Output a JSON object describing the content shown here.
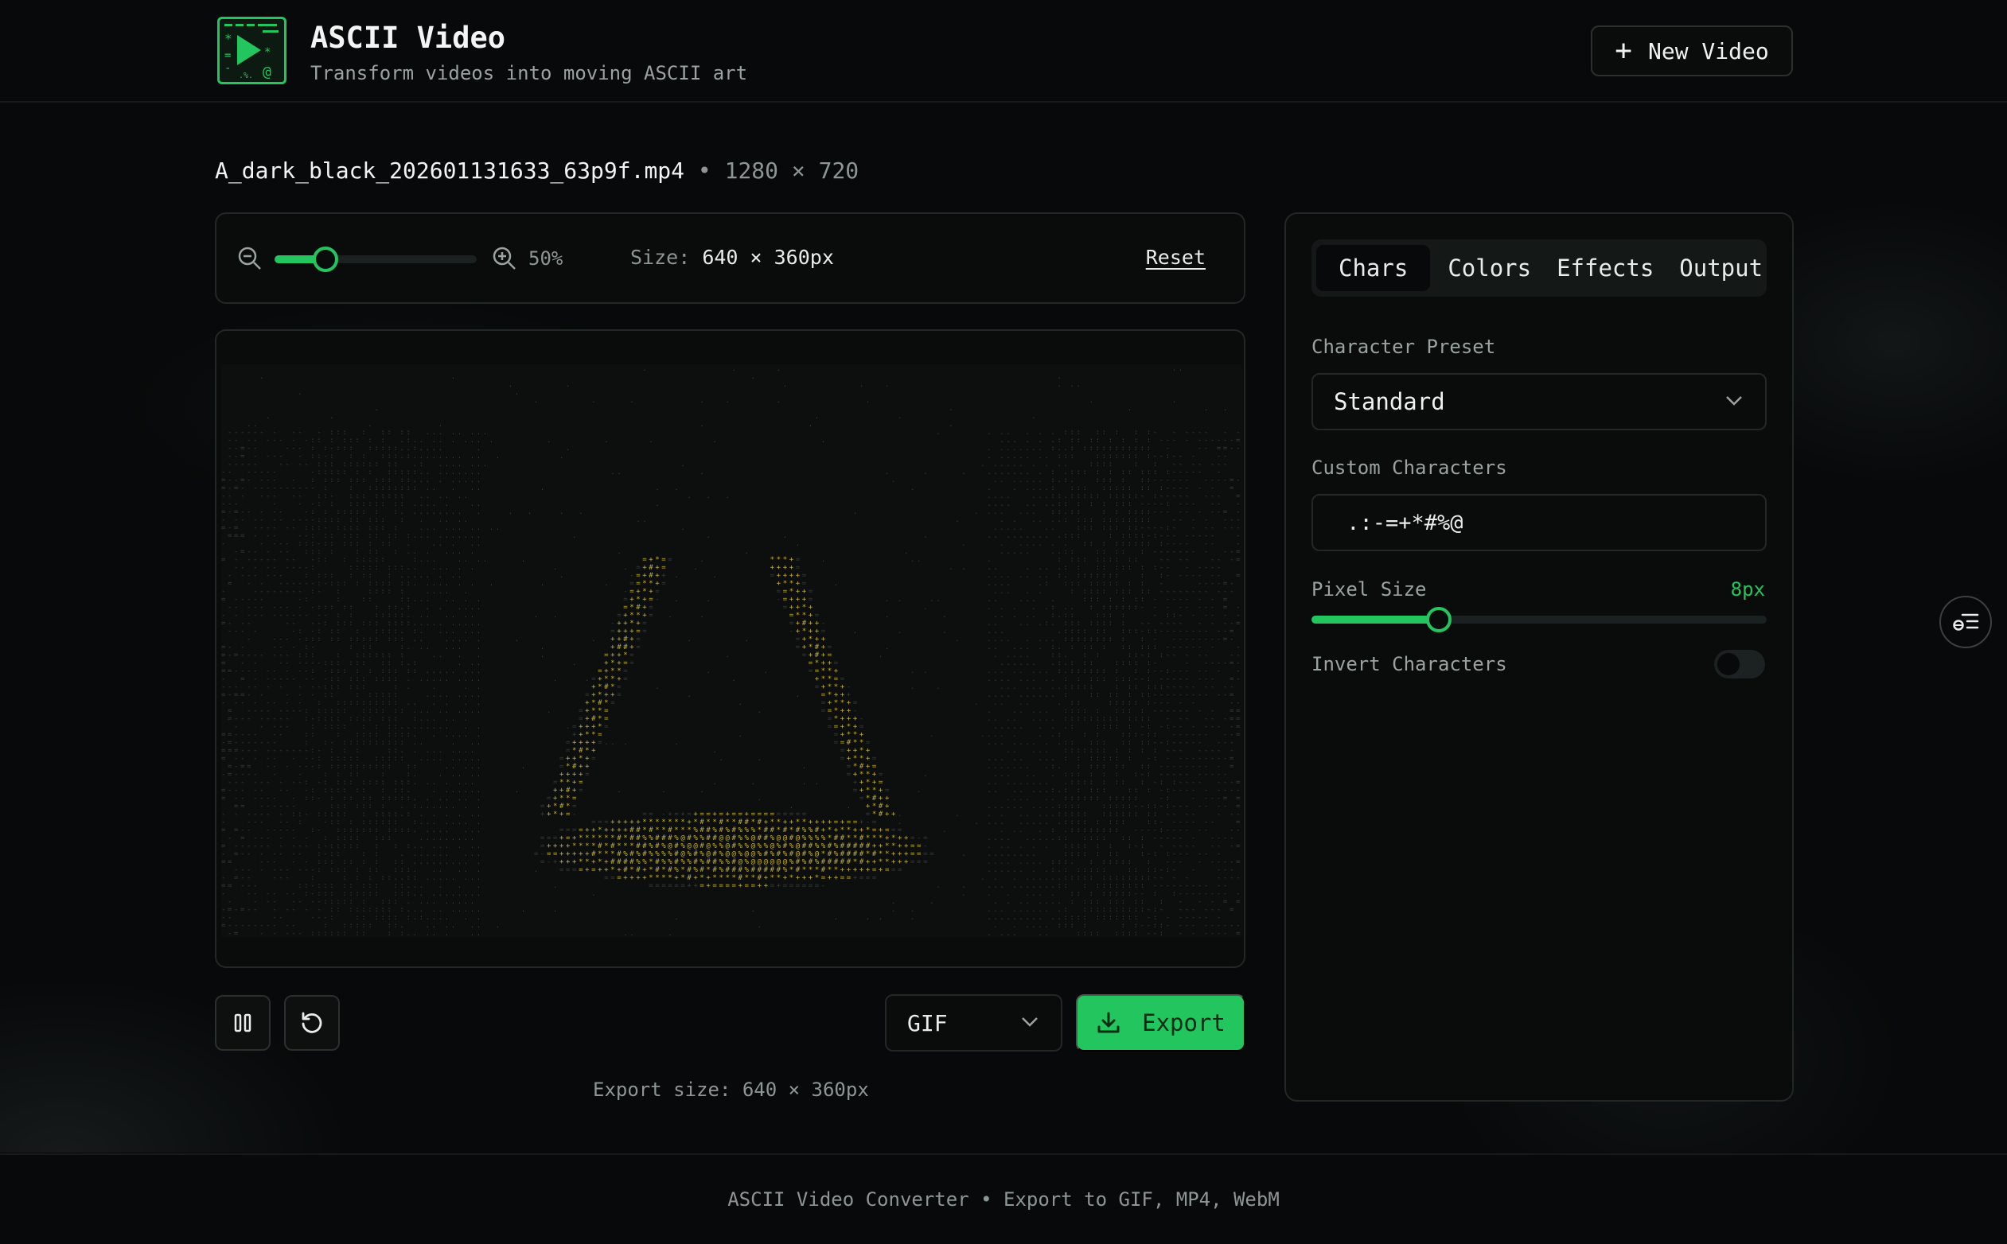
{
  "header": {
    "title": "ASCII Video",
    "subtitle": "Transform videos into moving ASCII art",
    "new_video_label": "New Video"
  },
  "file": {
    "name": "A_dark_black_202601131633_63p9f.mp4",
    "separator": "•",
    "resolution": "1280 × 720"
  },
  "zoom": {
    "value_label": "50%",
    "fraction": 0.25,
    "size_label": "Size:",
    "size_value": "640 × 360px",
    "reset_label": "Reset"
  },
  "controls": {
    "format": "GIF",
    "export_label": "Export",
    "export_size": "Export size: 640 × 360px"
  },
  "panel": {
    "tabs": [
      {
        "label": "Chars",
        "active": true
      },
      {
        "label": "Colors",
        "active": false
      },
      {
        "label": "Effects",
        "active": false
      },
      {
        "label": "Output",
        "active": false
      }
    ],
    "preset_label": "Character Preset",
    "preset_value": "Standard",
    "custom_label": "Custom Characters",
    "custom_value": " .:-=+*#%@",
    "pixel_label": "Pixel Size",
    "pixel_value": "8px",
    "pixel_fraction": 0.28,
    "invert_label": "Invert Characters",
    "invert_on": false
  },
  "footer": {
    "text": "ASCII Video Converter • Export to GIF, MP4, WebM"
  },
  "colors": {
    "accent": "#22c55e",
    "ascii_bright": "#c9b51e",
    "ascii_dim": "#3a3d3c"
  }
}
